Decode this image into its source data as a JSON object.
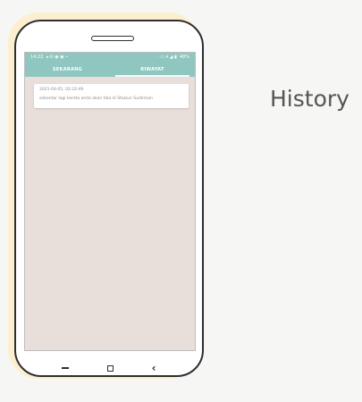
{
  "title": "History",
  "status": {
    "time": "14:22",
    "battery": "48%"
  },
  "tabs": [
    {
      "label": "SEKARANG",
      "active": false
    },
    {
      "label": "RIWAYAT",
      "active": true
    }
  ],
  "history": [
    {
      "timestamp": "2021-04-05, 02:22:49",
      "message": "sebentar lagi kereta anda akan tiba di Stasiun Sudirman"
    }
  ],
  "colors": {
    "accent": "#8fc6bf",
    "screen_bg": "#e8dfdb",
    "phone_glow": "#fcefcf"
  },
  "icons": [
    "back-nav-icon",
    "home-nav-icon",
    "recent-nav-icon"
  ]
}
